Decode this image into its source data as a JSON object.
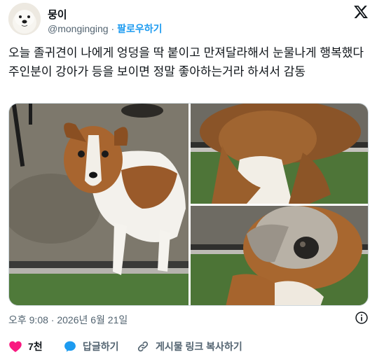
{
  "author": {
    "display_name": "뭉이",
    "handle": "@monginging",
    "separator": "·",
    "follow_label": "팔로우하기"
  },
  "tweet": {
    "text": "오늘 졸귀견이 나에게 엉덩을 딱 붙이고 만져달라해서 눈물나게 행복했다 주인분이 강아가 등을 보이면 정말 좋아하는거라 하셔서 감동"
  },
  "meta": {
    "timestamp": "오후 9:08 · 2026년 6월 21일"
  },
  "actions": {
    "like_count": "7천",
    "reply_label": "답글하기",
    "share_label": "게시물 링크 복사하기"
  },
  "colors": {
    "accent": "#1d9bf0",
    "like": "#f91880",
    "muted": "#536471"
  },
  "icons": [
    "x-logo-icon",
    "info-icon",
    "heart-icon",
    "reply-bubble-icon",
    "link-icon"
  ]
}
